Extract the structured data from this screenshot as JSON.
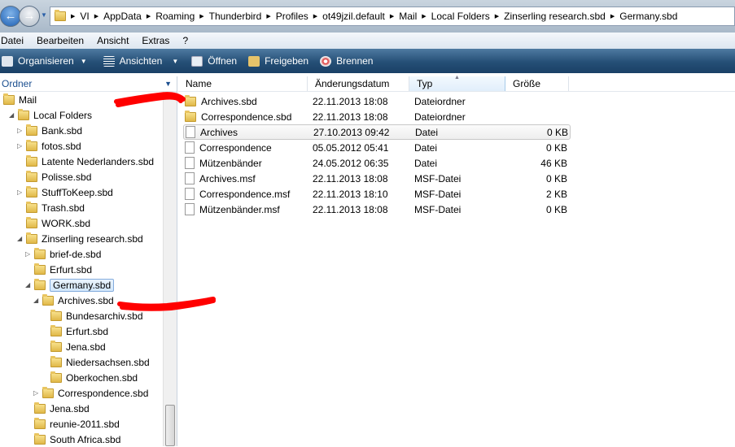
{
  "nav": {
    "back": "←",
    "forward": "→",
    "dropdown": "▼"
  },
  "breadcrumb": [
    "VI",
    "AppData",
    "Roaming",
    "Thunderbird",
    "Profiles",
    "ot49jzil.default",
    "Mail",
    "Local Folders",
    "Zinserling research.sbd",
    "Germany.sbd"
  ],
  "menu": [
    "Datei",
    "Bearbeiten",
    "Ansicht",
    "Extras",
    "?"
  ],
  "toolbar": {
    "organize": "Organisieren",
    "views": "Ansichten",
    "open": "Öffnen",
    "share": "Freigeben",
    "burn": "Brennen"
  },
  "tree_header": "Ordner",
  "tree": [
    {
      "label": "Mail",
      "level": 0,
      "exp": ""
    },
    {
      "label": "Local Folders",
      "level": 1,
      "exp": "open"
    },
    {
      "label": "Bank.sbd",
      "level": 2,
      "exp": "closed"
    },
    {
      "label": "fotos.sbd",
      "level": 2,
      "exp": "closed"
    },
    {
      "label": "Latente Nederlanders.sbd",
      "level": 2,
      "exp": ""
    },
    {
      "label": "Polisse.sbd",
      "level": 2,
      "exp": ""
    },
    {
      "label": "StuffToKeep.sbd",
      "level": 2,
      "exp": "closed"
    },
    {
      "label": "Trash.sbd",
      "level": 2,
      "exp": ""
    },
    {
      "label": "WORK.sbd",
      "level": 2,
      "exp": ""
    },
    {
      "label": "Zinserling research.sbd",
      "level": 2,
      "exp": "open"
    },
    {
      "label": "brief-de.sbd",
      "level": 3,
      "exp": "closed"
    },
    {
      "label": "Erfurt.sbd",
      "level": 3,
      "exp": ""
    },
    {
      "label": "Germany.sbd",
      "level": 3,
      "exp": "open",
      "selected": true
    },
    {
      "label": "Archives.sbd",
      "level": 4,
      "exp": "open"
    },
    {
      "label": "Bundesarchiv.sbd",
      "level": 5,
      "exp": ""
    },
    {
      "label": "Erfurt.sbd",
      "level": 5,
      "exp": ""
    },
    {
      "label": "Jena.sbd",
      "level": 5,
      "exp": ""
    },
    {
      "label": "Niedersachsen.sbd",
      "level": 5,
      "exp": ""
    },
    {
      "label": "Oberkochen.sbd",
      "level": 5,
      "exp": ""
    },
    {
      "label": "Correspondence.sbd",
      "level": 4,
      "exp": "closed"
    },
    {
      "label": "Jena.sbd",
      "level": 3,
      "exp": ""
    },
    {
      "label": "reunie-2011.sbd",
      "level": 3,
      "exp": ""
    },
    {
      "label": "South Africa.sbd",
      "level": 3,
      "exp": ""
    }
  ],
  "columns": {
    "name": "Name",
    "date": "Änderungsdatum",
    "type": "Typ",
    "size": "Größe"
  },
  "files": [
    {
      "name": "Archives.sbd",
      "date": "22.11.2013 18:08",
      "type": "Dateiordner",
      "size": "",
      "icon": "folder"
    },
    {
      "name": "Correspondence.sbd",
      "date": "22.11.2013 18:08",
      "type": "Dateiordner",
      "size": "",
      "icon": "folder"
    },
    {
      "name": "Archives",
      "date": "27.10.2013 09:42",
      "type": "Datei",
      "size": "0 KB",
      "icon": "file",
      "hover": true
    },
    {
      "name": "Correspondence",
      "date": "05.05.2012 05:41",
      "type": "Datei",
      "size": "0 KB",
      "icon": "file"
    },
    {
      "name": "Mützenbänder",
      "date": "24.05.2012 06:35",
      "type": "Datei",
      "size": "46 KB",
      "icon": "file"
    },
    {
      "name": "Archives.msf",
      "date": "22.11.2013 18:08",
      "type": "MSF-Datei",
      "size": "0 KB",
      "icon": "file"
    },
    {
      "name": "Correspondence.msf",
      "date": "22.11.2013 18:10",
      "type": "MSF-Datei",
      "size": "2 KB",
      "icon": "file"
    },
    {
      "name": "Mützenbänder.msf",
      "date": "22.11.2013 18:08",
      "type": "MSF-Datei",
      "size": "0 KB",
      "icon": "file"
    }
  ],
  "colors": {
    "annotation": "#ff0000",
    "toolbar": "#254f76"
  }
}
